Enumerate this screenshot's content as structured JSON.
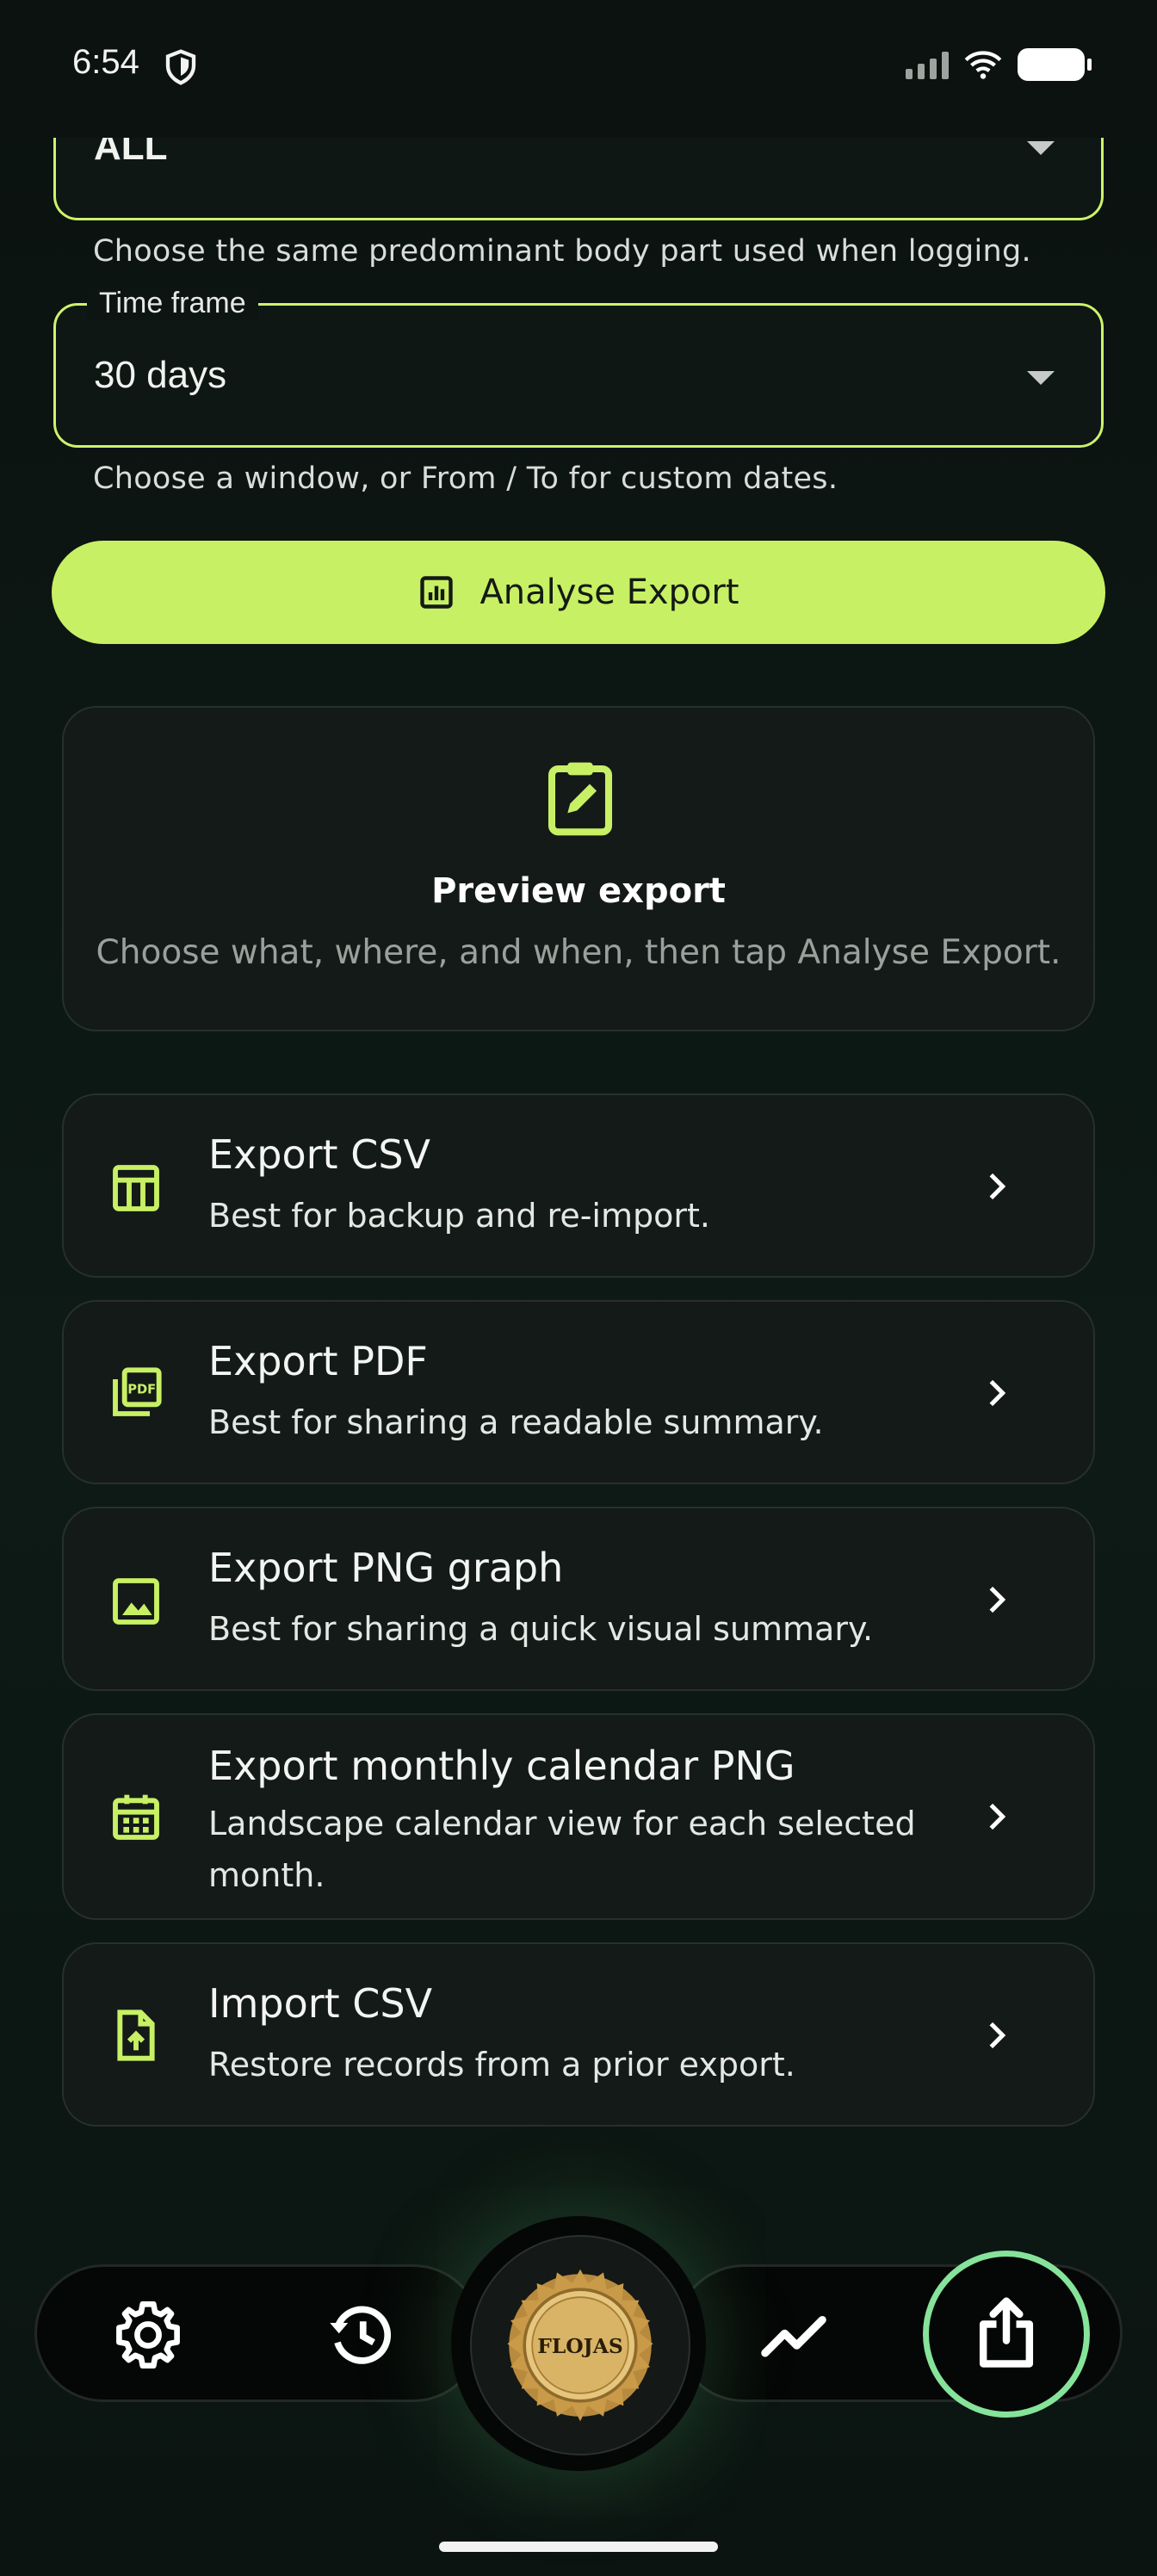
{
  "status_bar": {
    "time": "6:54"
  },
  "filters": {
    "body_part": {
      "value": "ALL",
      "helper": "Choose the same predominant body part used when logging."
    },
    "time_frame": {
      "label": "Time frame",
      "value": "30 days",
      "helper": "Choose a window, or From / To for custom dates."
    }
  },
  "analyse_button": {
    "label": "Analyse Export"
  },
  "preview": {
    "title": "Preview export",
    "subtitle": "Choose what, where, and when, then tap Analyse Export."
  },
  "export_options": [
    {
      "title": "Export CSV",
      "description": "Best for backup and re-import.",
      "icon": "table-icon"
    },
    {
      "title": "Export PDF",
      "description": "Best for sharing a readable summary.",
      "icon": "pdf-icon"
    },
    {
      "title": "Export PNG graph",
      "description": "Best for sharing a quick visual summary.",
      "icon": "image-icon"
    },
    {
      "title": "Export monthly calendar PNG",
      "description": "Landscape calendar view for each selected month.",
      "icon": "calendar-icon"
    },
    {
      "title": "Import CSV",
      "description": "Restore records from a prior export.",
      "icon": "file-upload-icon"
    }
  ],
  "bottom_nav": {
    "items": [
      "settings-icon",
      "history-icon",
      "logo",
      "trend-icon",
      "share-icon"
    ],
    "logo_text": "FLOJAS",
    "active": "share"
  },
  "colors": {
    "accent": "#c8f064",
    "active_ring": "#86e39a",
    "background": "#0b1411",
    "card": "#141a18"
  }
}
